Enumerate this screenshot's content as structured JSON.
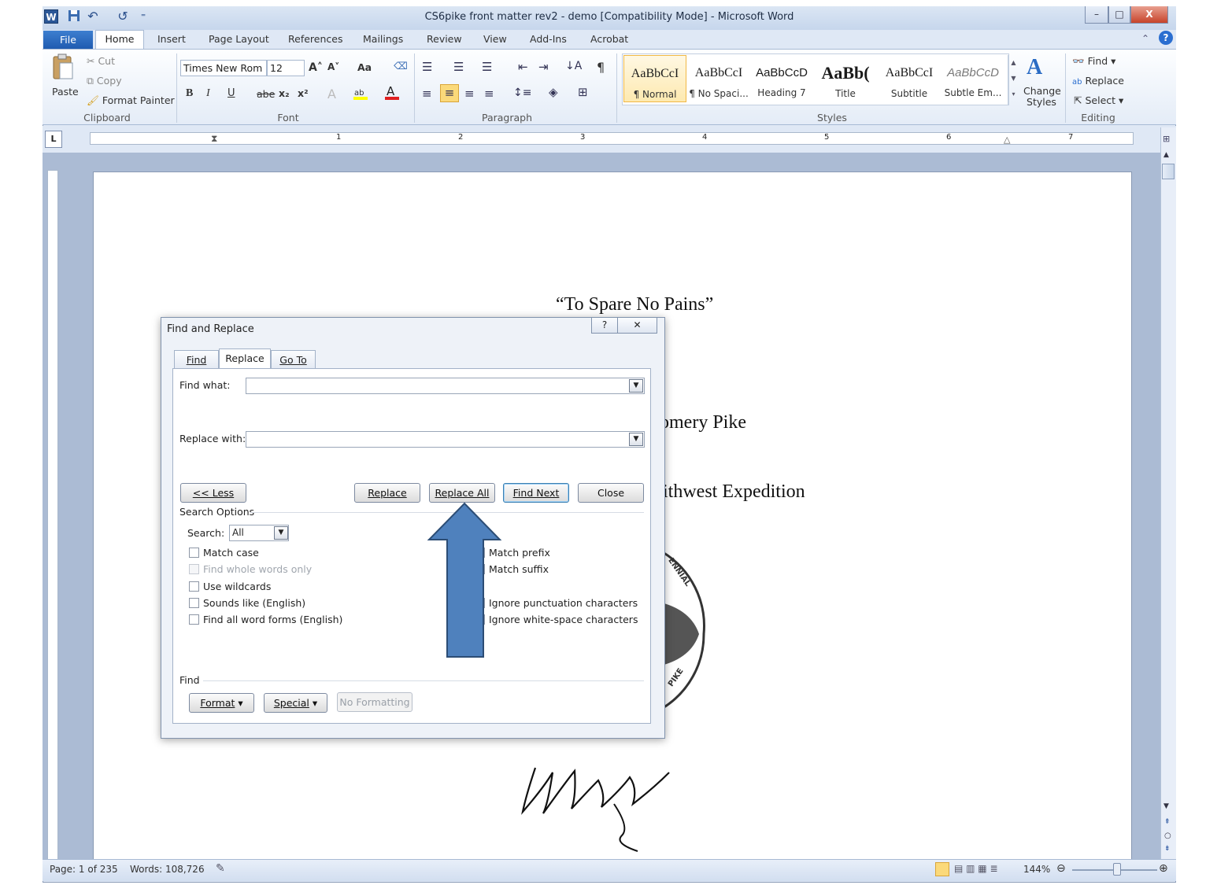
{
  "window": {
    "title": "CS6pike front matter rev2 - demo [Compatibility Mode] - Microsoft Word",
    "minimize": "–",
    "maximize": "□",
    "close": "X"
  },
  "qat": {
    "word_icon": "W",
    "save": "▾",
    "undo": "↶",
    "redo": "↺",
    "customize": "⁼"
  },
  "tabs": {
    "file": "File",
    "home": "Home",
    "insert": "Insert",
    "page_layout": "Page Layout",
    "references": "References",
    "mailings": "Mailings",
    "review": "Review",
    "view": "View",
    "add_ins": "Add-Ins",
    "acrobat": "Acrobat"
  },
  "clipboard": {
    "paste": "Paste",
    "cut": "Cut",
    "copy": "Copy",
    "format_painter": "Format Painter",
    "group": "Clipboard"
  },
  "font": {
    "family": "Times New Rom",
    "size": "12",
    "group": "Font",
    "bold": "B",
    "italic": "I",
    "underline": "U",
    "strike": "abe",
    "sub": "x₂",
    "sup": "x²",
    "grow": "A˄",
    "shrink": "A˅",
    "case": "Aa"
  },
  "paragraph": {
    "group": "Paragraph",
    "show_marks": "¶"
  },
  "styles": {
    "group": "Styles",
    "tiles": [
      {
        "sample": "AaBbCcI",
        "name": "¶ Normal"
      },
      {
        "sample": "AaBbCcI",
        "name": "¶ No Spaci..."
      },
      {
        "sample": "AaBbCcD",
        "name": "Heading 7"
      },
      {
        "sample": "AaBb(",
        "name": "Title"
      },
      {
        "sample": "AaBbCcI",
        "name": "Subtitle"
      },
      {
        "sample": "AaBbCcD",
        "name": "Subtle Em..."
      }
    ],
    "change_styles": "Change Styles"
  },
  "editing": {
    "group": "Editing",
    "find": "Find",
    "replace": "Replace",
    "select": "Select"
  },
  "ruler": {
    "marks": [
      "1",
      "2",
      "3",
      "4",
      "5",
      "6",
      "7"
    ]
  },
  "document": {
    "line1": "“To Spare No Pains”",
    "line2": "omery Pike",
    "line3": "ithwest Expedition",
    "seal_text_top": "ENNIAL",
    "seal_text_bottom": "PIKE"
  },
  "dialog": {
    "title": "Find and Replace",
    "help": "?",
    "close": "✕",
    "tabs": {
      "find": "Find",
      "replace": "Replace",
      "goto": "Go To"
    },
    "find_what_label": "Find what:",
    "replace_with_label": "Replace with:",
    "buttons": {
      "less": "<< Less",
      "replace": "Replace",
      "replace_all": "Replace All",
      "find_next": "Find Next",
      "close": "Close"
    },
    "search_options": "Search Options",
    "search_label": "Search:",
    "search_value": "All",
    "checks_left": [
      "Match case",
      "Find whole words only",
      "Use wildcards",
      "Sounds like (English)",
      "Find all word forms (English)"
    ],
    "checks_right": [
      "Match prefix",
      "Match suffix",
      "Ignore punctuation characters",
      "Ignore white-space characters"
    ],
    "find_section": "Find",
    "format": "Format",
    "special": "Special",
    "no_formatting": "No Formatting"
  },
  "status": {
    "page": "Page: 1 of 235",
    "words": "Words: 108,726",
    "zoom": "144%"
  },
  "colors": {
    "arrow": "#4f81bd",
    "arrow_border": "#2c4d75",
    "file_tab": "#2a66bd",
    "accent": "#1f5bb0"
  }
}
